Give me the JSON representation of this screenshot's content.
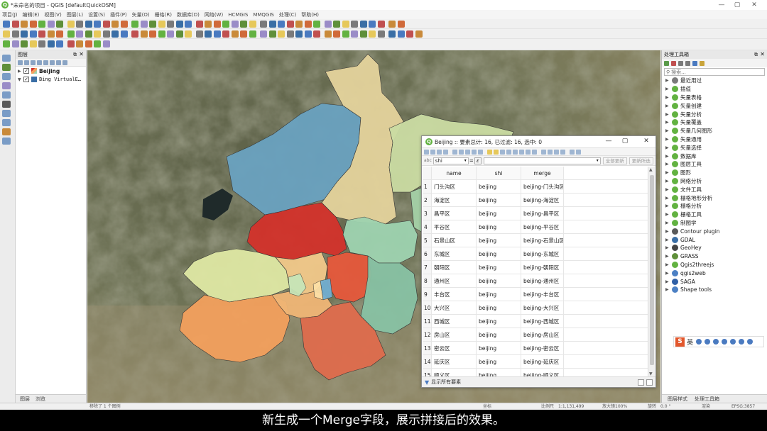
{
  "window": {
    "title": "*未命名的项目 - QGIS [defaultQuickOSM]",
    "logo": "Q",
    "controls": [
      "—",
      "▢",
      "✕"
    ]
  },
  "menu": [
    "项目(J)",
    "编辑(E)",
    "视图(V)",
    "图层(L)",
    "设置(S)",
    "插件(P)",
    "矢量(O)",
    "栅格(R)",
    "数据库(D)",
    "网络(W)",
    "HCMGIS",
    "MMQGIS",
    "处理(C)",
    "帮助(H)"
  ],
  "layers_panel": {
    "title": "图层",
    "layers": [
      {
        "name": "Beijing",
        "checked": true,
        "expanded": false
      },
      {
        "name": "Bing VirtualE…",
        "checked": true,
        "expanded": true
      }
    ],
    "tabs": [
      "图层",
      "浏览"
    ]
  },
  "attribute_table": {
    "title": "Beijing :: 要素总计: 16, 已过滤: 16, 选中: 0",
    "field_selector": "shi",
    "buttons": {
      "update_all": "全部更新",
      "update_selected": "更新所选"
    },
    "columns": [
      "name",
      "shi",
      "merge"
    ],
    "rows": [
      {
        "id": "1",
        "name": "门头沟区",
        "shi": "beijing",
        "merge": "beijing-门头沟区"
      },
      {
        "id": "2",
        "name": "海淀区",
        "shi": "beijing",
        "merge": "beijing-海淀区"
      },
      {
        "id": "3",
        "name": "昌平区",
        "shi": "beijing",
        "merge": "beijing-昌平区"
      },
      {
        "id": "4",
        "name": "平谷区",
        "shi": "beijing",
        "merge": "beijing-平谷区"
      },
      {
        "id": "5",
        "name": "石景山区",
        "shi": "beijing",
        "merge": "beijing-石景山区"
      },
      {
        "id": "6",
        "name": "东城区",
        "shi": "beijing",
        "merge": "beijing-东城区"
      },
      {
        "id": "7",
        "name": "朝阳区",
        "shi": "beijing",
        "merge": "beijing-朝阳区"
      },
      {
        "id": "8",
        "name": "通州区",
        "shi": "beijing",
        "merge": "beijing-通州区"
      },
      {
        "id": "9",
        "name": "丰台区",
        "shi": "beijing",
        "merge": "beijing-丰台区"
      },
      {
        "id": "10",
        "name": "大兴区",
        "shi": "beijing",
        "merge": "beijing-大兴区"
      },
      {
        "id": "11",
        "name": "西城区",
        "shi": "beijing",
        "merge": "beijing-西城区"
      },
      {
        "id": "12",
        "name": "房山区",
        "shi": "beijing",
        "merge": "beijing-房山区"
      },
      {
        "id": "13",
        "name": "密云区",
        "shi": "beijing",
        "merge": "beijing-密云区"
      },
      {
        "id": "14",
        "name": "延庆区",
        "shi": "beijing",
        "merge": "beijing-延庆区"
      },
      {
        "id": "15",
        "name": "顺义区",
        "shi": "beijing",
        "merge": "beijing-顺义区"
      }
    ],
    "footer": "显示所有要素"
  },
  "processing": {
    "title": "处理工具箱",
    "search_placeholder": "搜索...",
    "items": [
      {
        "label": "最近用过",
        "icon": "clock-icon",
        "color": "#7a7a7a"
      },
      {
        "label": "插值",
        "icon": "qgis-icon",
        "color": "#62b241"
      },
      {
        "label": "矢量表格",
        "icon": "qgis-icon",
        "color": "#62b241"
      },
      {
        "label": "矢量创建",
        "icon": "qgis-icon",
        "color": "#62b241"
      },
      {
        "label": "矢量分析",
        "icon": "qgis-icon",
        "color": "#62b241"
      },
      {
        "label": "矢量覆盖",
        "icon": "qgis-icon",
        "color": "#62b241"
      },
      {
        "label": "矢量几何图形",
        "icon": "qgis-icon",
        "color": "#62b241"
      },
      {
        "label": "矢量通用",
        "icon": "qgis-icon",
        "color": "#62b241"
      },
      {
        "label": "矢量选择",
        "icon": "qgis-icon",
        "color": "#62b241"
      },
      {
        "label": "数据库",
        "icon": "qgis-icon",
        "color": "#62b241"
      },
      {
        "label": "图层工具",
        "icon": "qgis-icon",
        "color": "#62b241"
      },
      {
        "label": "图形",
        "icon": "qgis-icon",
        "color": "#62b241"
      },
      {
        "label": "网络分析",
        "icon": "qgis-icon",
        "color": "#62b241"
      },
      {
        "label": "文件工具",
        "icon": "qgis-icon",
        "color": "#62b241"
      },
      {
        "label": "栅格地形分析",
        "icon": "qgis-icon",
        "color": "#62b241"
      },
      {
        "label": "栅格分析",
        "icon": "qgis-icon",
        "color": "#62b241"
      },
      {
        "label": "栅格工具",
        "icon": "qgis-icon",
        "color": "#62b241"
      },
      {
        "label": "制图学",
        "icon": "qgis-icon",
        "color": "#62b241"
      },
      {
        "label": "Contour plugin",
        "icon": "contour-icon",
        "color": "#5a5a5a"
      },
      {
        "label": "GDAL",
        "icon": "gdal-icon",
        "color": "#3a6ea5"
      },
      {
        "label": "GeoHey",
        "icon": "geohey-icon",
        "color": "#444444"
      },
      {
        "label": "GRASS",
        "icon": "grass-icon",
        "color": "#5f8f3a"
      },
      {
        "label": "Qgis2threejs",
        "icon": "threejs-icon",
        "color": "#62b241"
      },
      {
        "label": "qgis2web",
        "icon": "web-icon",
        "color": "#4c80c4"
      },
      {
        "label": "SAGA",
        "icon": "saga-icon",
        "color": "#2f5fa6"
      },
      {
        "label": "Shape tools",
        "icon": "shape-icon",
        "color": "#4c80c4"
      }
    ],
    "tabs": [
      "图层样式",
      "处理工具箱"
    ]
  },
  "ime": {
    "logo": "S",
    "lang": "英"
  },
  "statusbar": {
    "left": "移除了 1 个图例",
    "coord_label": "坐标",
    "scale_label": "比例尺",
    "scale": "1:1,131,499",
    "magnifier_label": "放大镜",
    "magnifier": "100%",
    "rotation_label": "旋转",
    "rotation": "0.0 °",
    "render_label": "渲染",
    "crs": "EPSG:3857"
  },
  "subtitle": "新生成一个Merge字段，展示拼接后的效果。",
  "map": {
    "district_colors": {
      "延庆区": "#6aa2c0",
      "怀柔区": "#e4d39c",
      "密云区": "#cbdca3",
      "平谷区": "#a5d1a7",
      "昌平区": "#d3322b",
      "顺义区": "#9ed3b0",
      "门头沟区": "#dfe8a4",
      "海淀区": "#f2c98a",
      "朝阳区": "#e6583b",
      "通州区": "#88c2a4",
      "房山区": "#f3a05d",
      "丰台区": "#f0b676",
      "大兴区": "#df6c4d",
      "石景山区": "#c7e5b8",
      "东城区": "#71aed0",
      "西城区": "#fde0a6"
    }
  }
}
